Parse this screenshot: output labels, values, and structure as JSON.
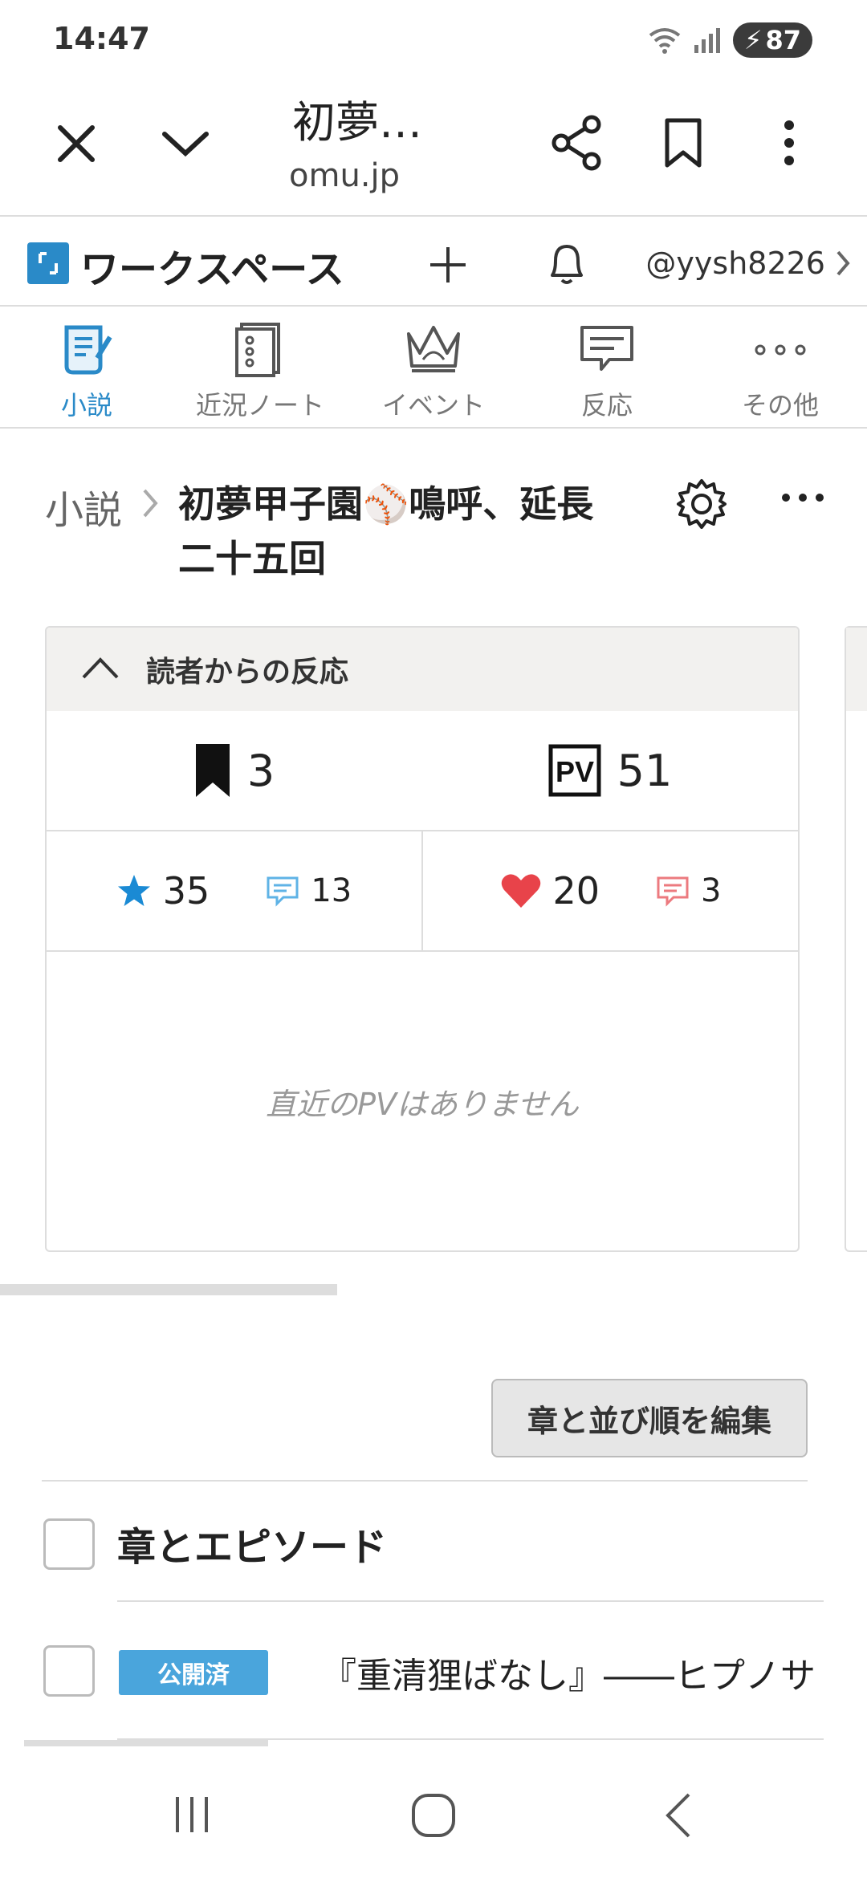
{
  "status_bar": {
    "time": "14:47",
    "battery": "87"
  },
  "browser": {
    "title": "初夢…",
    "url": "omu.jp"
  },
  "workspace": {
    "title": "ワークスペース",
    "user": "@yysh8226"
  },
  "nav_tabs": [
    {
      "label": "小説",
      "icon": "scroll-pen-icon",
      "active": true
    },
    {
      "label": "近況ノート",
      "icon": "notebook-icon",
      "active": false
    },
    {
      "label": "イベント",
      "icon": "crown-icon",
      "active": false
    },
    {
      "label": "反応",
      "icon": "speech-bubble-icon",
      "active": false
    },
    {
      "label": "その他",
      "icon": "more-dots-icon",
      "active": false
    }
  ],
  "breadcrumb": {
    "root": "小説",
    "title": "初夢甲子園⚾鳴呼、延長二十五回"
  },
  "reactions": {
    "header": "読者からの反応",
    "bookmarks": "3",
    "pv": "51",
    "stars": "35",
    "star_comments": "13",
    "hearts": "20",
    "heart_comments": "3",
    "empty_message": "直近のPVはありません"
  },
  "edit_button": "章と並び順を編集",
  "episodes": {
    "header": "章とエピソード",
    "items": [
      {
        "status": "公開済",
        "title": "『重清狸ばなし』――ヒプノサ"
      }
    ]
  },
  "colors": {
    "accent": "#2a8ac8",
    "heart": "#e8434a",
    "badge": "#4aa5dc"
  }
}
